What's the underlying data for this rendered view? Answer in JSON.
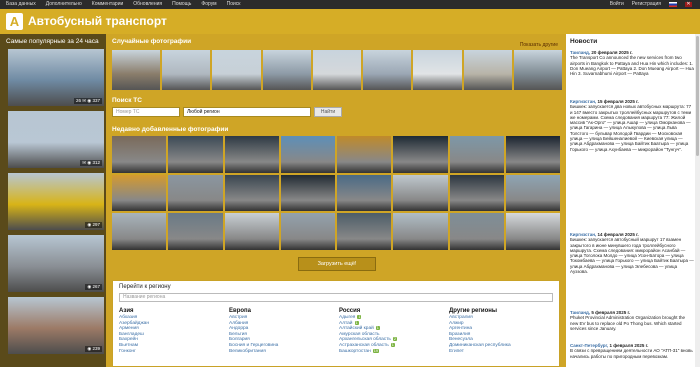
{
  "topnav": [
    "База данных",
    "Дополнительно",
    "Комментарии",
    "Обновления",
    "Помощь",
    "Форум",
    "Поиск"
  ],
  "topright": {
    "login": "Войти",
    "register": "Регистрация"
  },
  "header": {
    "logo_letter": "А",
    "title": "Автобусный транспорт"
  },
  "left": {
    "title": "Самые популярные за 24 часа",
    "cards": [
      {
        "stats": "26  ✉  ◉ 337",
        "color": "#6f8aa3"
      },
      {
        "stats": "✉  ◉ 312",
        "color": "#b9c7d4"
      },
      {
        "stats": "◉ 297",
        "color": "#d8b417"
      },
      {
        "stats": "◉ 267",
        "color": "#8a8f95"
      },
      {
        "stats": "◉ 239",
        "color": "#9c7a66"
      }
    ]
  },
  "center": {
    "random_title": "Случайные фотографии",
    "show_other": "Показать другие",
    "random_colors": [
      "#8a7d6b",
      "#b0b8c0",
      "#c7d0d7",
      "#8d9aa6",
      "#d5d8db",
      "#9ba7b4",
      "#e1e4e6",
      "#b8b4a8",
      "#7f8b93"
    ],
    "search_title": "Поиск ТС",
    "search_placeholder": "Номер ТС",
    "region_value": "Любой регион",
    "find_button": "Найти",
    "recent_title": "Недавно добавленные фотографии",
    "grid_colors": [
      "#7a6a5a",
      "#3c4a56",
      "#2e3a44",
      "#5d8fb8",
      "#c08a2a",
      "#1e2a34",
      "#7d98a8",
      "#1b2430",
      "#d49a2f",
      "#8a96a0",
      "#3a4650",
      "#222b33",
      "#4a6a86",
      "#bfc8ce",
      "#2c3640",
      "#8ea4b3",
      "#a8b4bc",
      "#6a7a86",
      "#c8cfd4",
      "#93a2ad",
      "#4d5d68",
      "#b0bdc6",
      "#7e8e98",
      "#d5d9dc"
    ],
    "load_more": "Загрузить ещё!"
  },
  "regions": {
    "title": "Перейти к региону",
    "placeholder": "Название региона",
    "columns": [
      {
        "name": "Азия",
        "items": [
          [
            "Абхазия",
            ""
          ],
          [
            "Азербайджан",
            ""
          ],
          [
            "Армения",
            ""
          ],
          [
            "Бангладеш",
            ""
          ],
          [
            "Бахрейн",
            ""
          ],
          [
            "Вьетнам",
            ""
          ],
          [
            "Гонконг",
            ""
          ]
        ]
      },
      {
        "name": "Европа",
        "items": [
          [
            "Австрия",
            ""
          ],
          [
            "Албания",
            ""
          ],
          [
            "Андорра",
            ""
          ],
          [
            "Бельгия",
            ""
          ],
          [
            "Болгария",
            ""
          ],
          [
            "Босния и Герцеговина",
            ""
          ],
          [
            "Великобритания",
            ""
          ]
        ]
      },
      {
        "name": "Россия",
        "items": [
          [
            "Адыгея",
            "1"
          ],
          [
            "Алтай",
            "1"
          ],
          [
            "Алтайский край",
            "1"
          ],
          [
            "Амурская область",
            ""
          ],
          [
            "Архангельская область",
            "2"
          ],
          [
            "Астраханская область",
            "1"
          ],
          [
            "Башкортостан",
            "19"
          ]
        ]
      },
      {
        "name": "Другие регионы",
        "items": [
          [
            "Австралия",
            ""
          ],
          [
            "Алжир",
            ""
          ],
          [
            "Аргентина",
            ""
          ],
          [
            "Бразилия",
            ""
          ],
          [
            "Венесуэла",
            ""
          ],
          [
            "Доминиканская республика",
            ""
          ],
          [
            "Египет",
            ""
          ]
        ]
      }
    ]
  },
  "news": {
    "title": "Новости",
    "items": [
      {
        "city": "Таиланд,",
        "date": " 20 февраля 2025 г.",
        "text": "The Transport Co announced the new services from two airports in Bangkok to Pattaya and Hua Hin which includes: 1. Don Mueang Airport — Pattaya 2. Don Mueang Airport — Hua Hin 3. Suvarnabhumi Airport — Pattaya"
      },
      {
        "city": "Киргизстан,",
        "date": " 15 февраля 2025 г.",
        "text": "Бишкек: запускается два новых автобусных маршрута: 77 и 147 вместо закрытых троллейбусных маршрутов с теми же номерами. Схема следования маршрута 77: Жилой массив \"Ак-Орго\" — улица Ашар — улица Оморканова — улица Гагарина — улица Алыкулова — улица Льва Толстого — бульвар Молодой Гвардии — Московская улица — улица Бейшеналиевой — Киевская улица — улица Абдрахманова — улица Байтик Баатыра — улица Горького — улица Ахунбаева — микрорайон \"Тунгуч\"."
      },
      {
        "city": "Киргизстан,",
        "date": " 14 февраля 2025 г.",
        "text": "Бишкек: запускается автобусный маршрут 17 взамен закрытого в июне минувшего года троллейбусного маршрута. Схема следования: микрорайон Асанбай — улица Тоголока Молдо — улица Усон-Батора — улица Токомбаева — улица Горького — улица Байтик Баатыра — улица Абдрахманова — улица Элебесова — улица Ауэзова."
      },
      {
        "city": "Таиланд,",
        "date": " 5 февраля 2025 г.",
        "text": "Phuket Provincial Administration Organization brought the new EV bus to replace old Po Thong bus. Which started services since January."
      },
      {
        "city": "Санкт-Петербург,",
        "date": " 1 февраля 2025 г.",
        "text": "В связи с превращением деятельности АО \"АТП-31\" вновь начались работы по пригородным перевозкам."
      }
    ]
  }
}
